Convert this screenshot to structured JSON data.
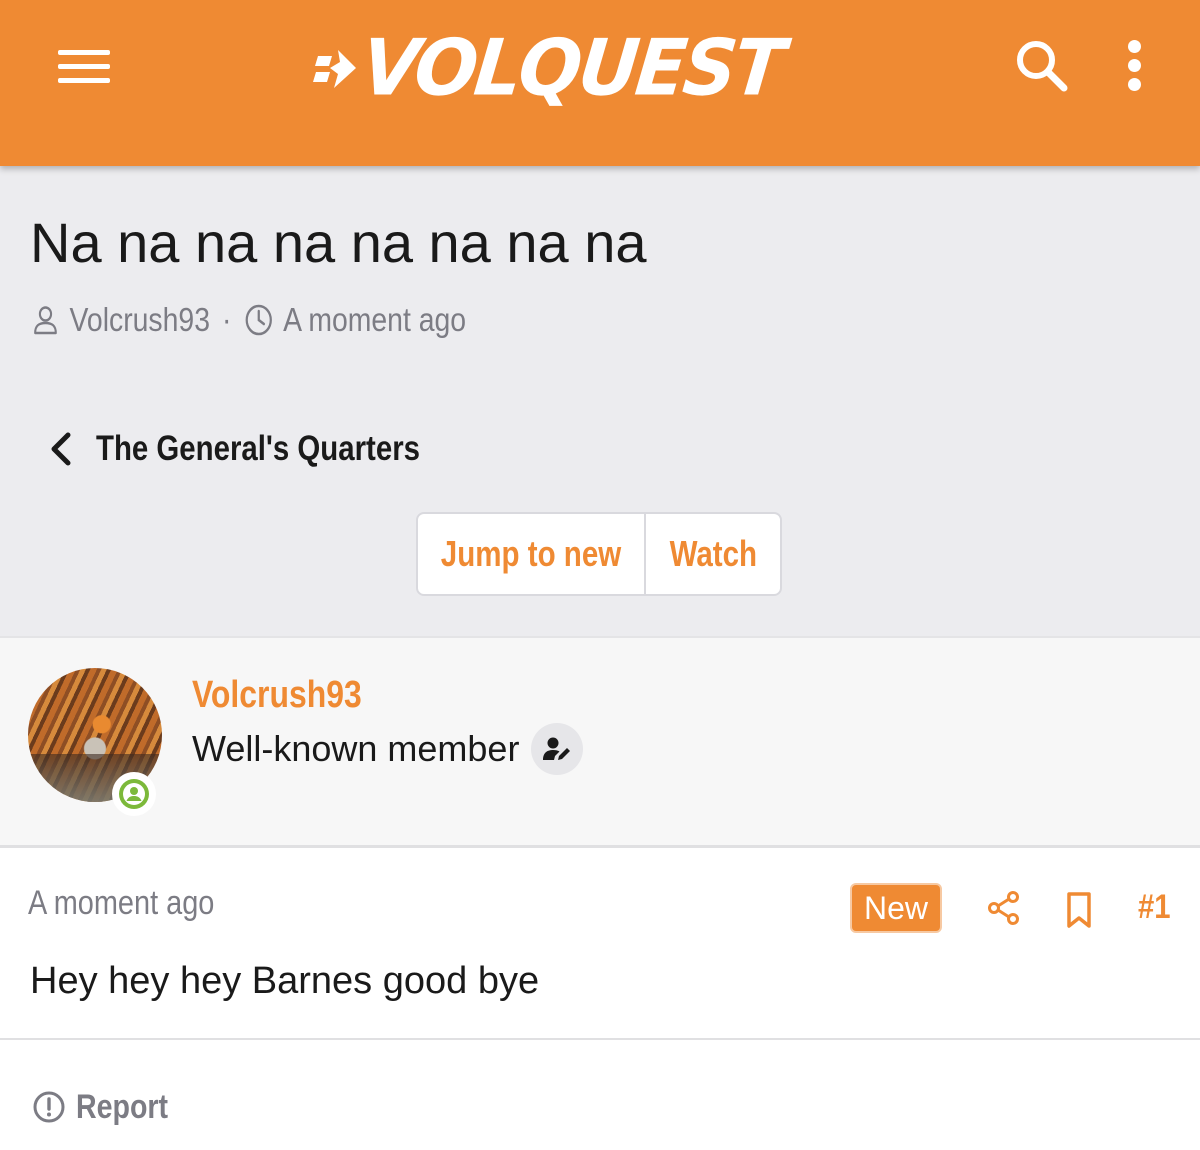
{
  "header": {
    "logo_text": "VOLQUEST",
    "menu_icon": "hamburger-icon",
    "search_icon": "search-icon",
    "more_icon": "kebab-menu-icon",
    "background_color": "#ef8a33"
  },
  "thread": {
    "title": "Na na na na na na na na",
    "author": "Volcrush93",
    "time": "A moment ago",
    "meta_separator": "·",
    "breadcrumb_label": "The General's Quarters"
  },
  "actions": {
    "jump_to_new": "Jump to new",
    "watch": "Watch"
  },
  "post": {
    "author_name": "Volcrush93",
    "author_role": "Well-known member",
    "time": "A moment ago",
    "new_badge": "New",
    "post_number": "#1",
    "text": "Hey hey hey Barnes good bye",
    "report_label": "Report"
  },
  "colors": {
    "accent": "#ef8a33",
    "muted_text": "#7c7c84",
    "online": "#7cb93a",
    "header_bg": "#ececef"
  }
}
